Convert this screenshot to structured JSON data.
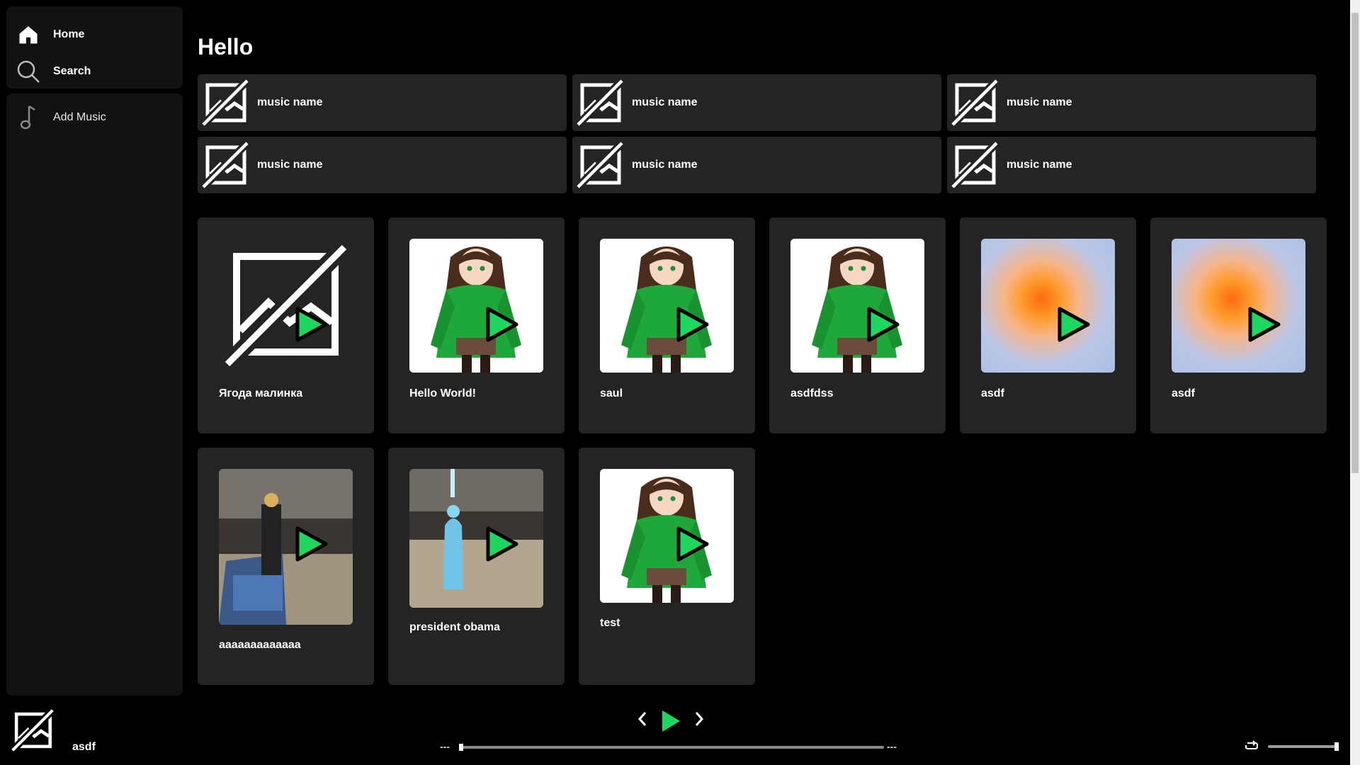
{
  "sidebar": {
    "nav": [
      {
        "label": "Home",
        "icon": "home-icon"
      },
      {
        "label": "Search",
        "icon": "search-icon"
      }
    ],
    "library": {
      "add_label": "Add Music",
      "icon": "music-note-icon"
    }
  },
  "main": {
    "greeting": "Hello",
    "quick_items": [
      {
        "name": "music name"
      },
      {
        "name": "music name"
      },
      {
        "name": "music name"
      },
      {
        "name": "music name"
      },
      {
        "name": "music name"
      },
      {
        "name": "music name"
      }
    ],
    "cards": [
      {
        "title": "Ягода малинка",
        "art": "no-image-icon"
      },
      {
        "title": "Hello World!",
        "art": "anime-girl-green-hoodie"
      },
      {
        "title": "saul",
        "art": "anime-girl-green-hoodie"
      },
      {
        "title": "asdfdss",
        "art": "anime-girl-green-hoodie"
      },
      {
        "title": "asdf",
        "art": "orange-blue-gradient"
      },
      {
        "title": "asdf",
        "art": "orange-blue-gradient"
      },
      {
        "title": "aaaaaaaaaaaaa",
        "art": "game-scene"
      },
      {
        "title": "president obama",
        "art": "game-scene"
      },
      {
        "title": "test",
        "art": "anime-girl-green-hoodie"
      }
    ]
  },
  "player": {
    "title": "asdf",
    "time_current": "---",
    "time_total": "---",
    "icons": {
      "prev": "chevron-left-icon",
      "play": "play-icon",
      "next": "chevron-right-icon",
      "repeat": "repeat-icon"
    },
    "progress": 0,
    "volume": 1
  },
  "colors": {
    "accent": "#1ed760",
    "panel": "#121212",
    "card": "#242424",
    "background": "#000000"
  }
}
